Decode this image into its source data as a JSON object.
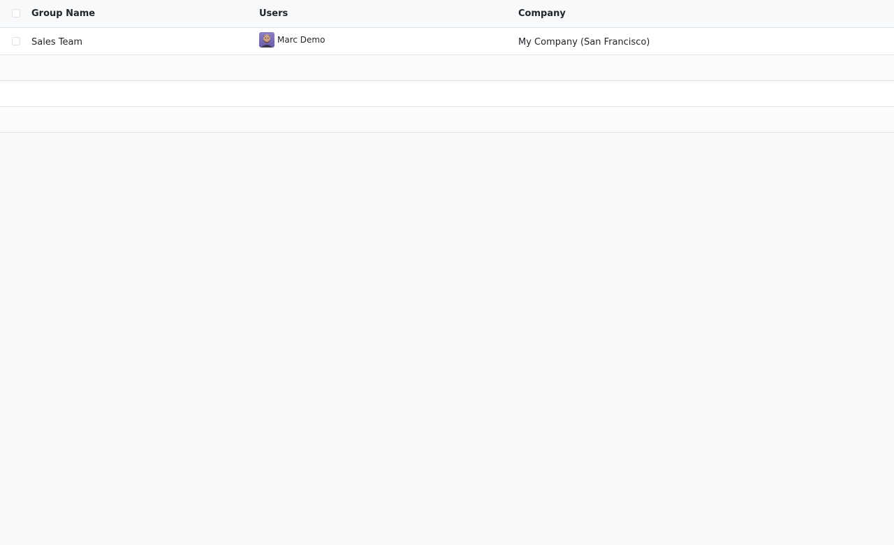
{
  "list": {
    "columns": {
      "group_name": "Group Name",
      "users": "Users",
      "company": "Company"
    },
    "rows": [
      {
        "group_name": "Sales Team",
        "user": {
          "name": "Marc Demo",
          "avatar_icon": "user-avatar-photo"
        },
        "company": "My Company (San Francisco)"
      }
    ]
  },
  "colors": {
    "page_background": "#f8f9fa",
    "row_border": "#dee2e6",
    "text": "#212529"
  }
}
